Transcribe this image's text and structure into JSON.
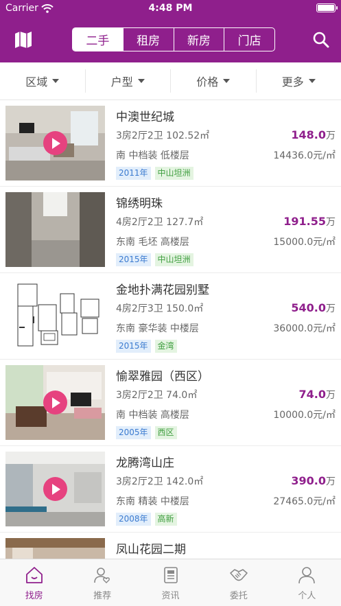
{
  "status_bar": {
    "carrier": "Carrier",
    "time": "4:48 PM"
  },
  "header": {
    "segments": [
      {
        "label": "二手",
        "active": true
      },
      {
        "label": "租房",
        "active": false
      },
      {
        "label": "新房",
        "active": false
      },
      {
        "label": "门店",
        "active": false
      }
    ],
    "left_icon": "map-icon",
    "right_icon": "search-icon",
    "accent_color": "#8f1f8c"
  },
  "filters": [
    "区域",
    "户型",
    "价格",
    "更多"
  ],
  "listings": [
    {
      "title": "中澳世纪城",
      "specs": "3房2厅2卫 102.52㎡",
      "price": "148.0",
      "price_unit": "万",
      "attrs": "南 中档装 低楼层",
      "unit_price": "14436.0元/㎡",
      "year": "2011年",
      "area": "中山坦洲",
      "video": true
    },
    {
      "title": "锦绣明珠",
      "specs": "4房2厅2卫 127.7㎡",
      "price": "191.55",
      "price_unit": "万",
      "attrs": "东南 毛坯 高楼层",
      "unit_price": "15000.0元/㎡",
      "year": "2015年",
      "area": "中山坦洲",
      "video": false
    },
    {
      "title": "金地扑满花园别墅",
      "specs": "4房2厅3卫 150.0㎡",
      "price": "540.0",
      "price_unit": "万",
      "attrs": "东南 豪华装 中楼层",
      "unit_price": "36000.0元/㎡",
      "year": "2015年",
      "area": "金湾",
      "video": false
    },
    {
      "title": "愉翠雅园（西区）",
      "specs": "3房2厅2卫 74.0㎡",
      "price": "74.0",
      "price_unit": "万",
      "attrs": "南 中档装 高楼层",
      "unit_price": "10000.0元/㎡",
      "year": "2005年",
      "area": "西区",
      "video": true
    },
    {
      "title": "龙腾湾山庄",
      "specs": "3房2厅2卫 142.0㎡",
      "price": "390.0",
      "price_unit": "万",
      "attrs": "东南 精装 中楼层",
      "unit_price": "27465.0元/㎡",
      "year": "2008年",
      "area": "高新",
      "video": true
    },
    {
      "title": "凤山花园二期"
    }
  ],
  "tabbar": [
    {
      "label": "找房",
      "icon": "home-icon",
      "active": true
    },
    {
      "label": "推荐",
      "icon": "user-heart-icon",
      "active": false
    },
    {
      "label": "资讯",
      "icon": "news-icon",
      "active": false
    },
    {
      "label": "委托",
      "icon": "handshake-icon",
      "active": false
    },
    {
      "label": "个人",
      "icon": "person-icon",
      "active": false
    }
  ]
}
